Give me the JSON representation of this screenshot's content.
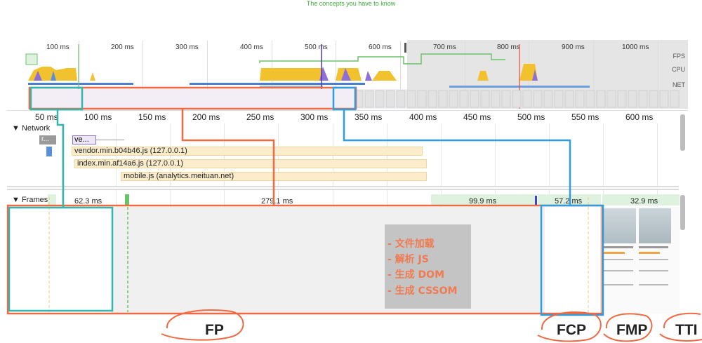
{
  "caption": "The concepts you have to know",
  "overview": {
    "ticks": [
      "100 ms",
      "200 ms",
      "300 ms",
      "400 ms",
      "500 ms",
      "600 ms",
      "700 ms",
      "800 ms",
      "900 ms",
      "1000 ms"
    ],
    "tracks": [
      "FPS",
      "CPU",
      "NET"
    ]
  },
  "main_ruler": {
    "ticks": [
      "50 ms",
      "100 ms",
      "150 ms",
      "200 ms",
      "250 ms",
      "300 ms",
      "350 ms",
      "400 ms",
      "450 ms",
      "500 ms",
      "550 ms",
      "600 ms"
    ]
  },
  "network": {
    "title": "Network",
    "small_items": [
      "r...",
      "ve..."
    ],
    "requests": [
      "vendor.min.b04b46.js (127.0.0.1)",
      "index.min.af14a6.js (127.0.0.1)",
      "mobile.js (analytics.meituan.net)"
    ]
  },
  "frames": {
    "title": "Frames",
    "durations": [
      "62.3 ms",
      "279.1 ms",
      "99.9 ms",
      "57.2 ms",
      "32.9 ms"
    ]
  },
  "legend": {
    "lines": [
      "- 文件加载",
      "- 解析 JS",
      "- 生成 DOM",
      "- 生成 CSSOM"
    ]
  },
  "metrics": {
    "fp": "FP",
    "fcp": "FCP",
    "fmp": "FMP",
    "tti": "TTI"
  },
  "colors": {
    "annotation_orange": "#ef6a43",
    "annotation_teal": "#34b6b0",
    "annotation_blue": "#2e9ee0",
    "cpu_yellow": "#f2c12e",
    "cpu_purple": "#8e6fd8",
    "fps_green": "#6cc26c"
  }
}
